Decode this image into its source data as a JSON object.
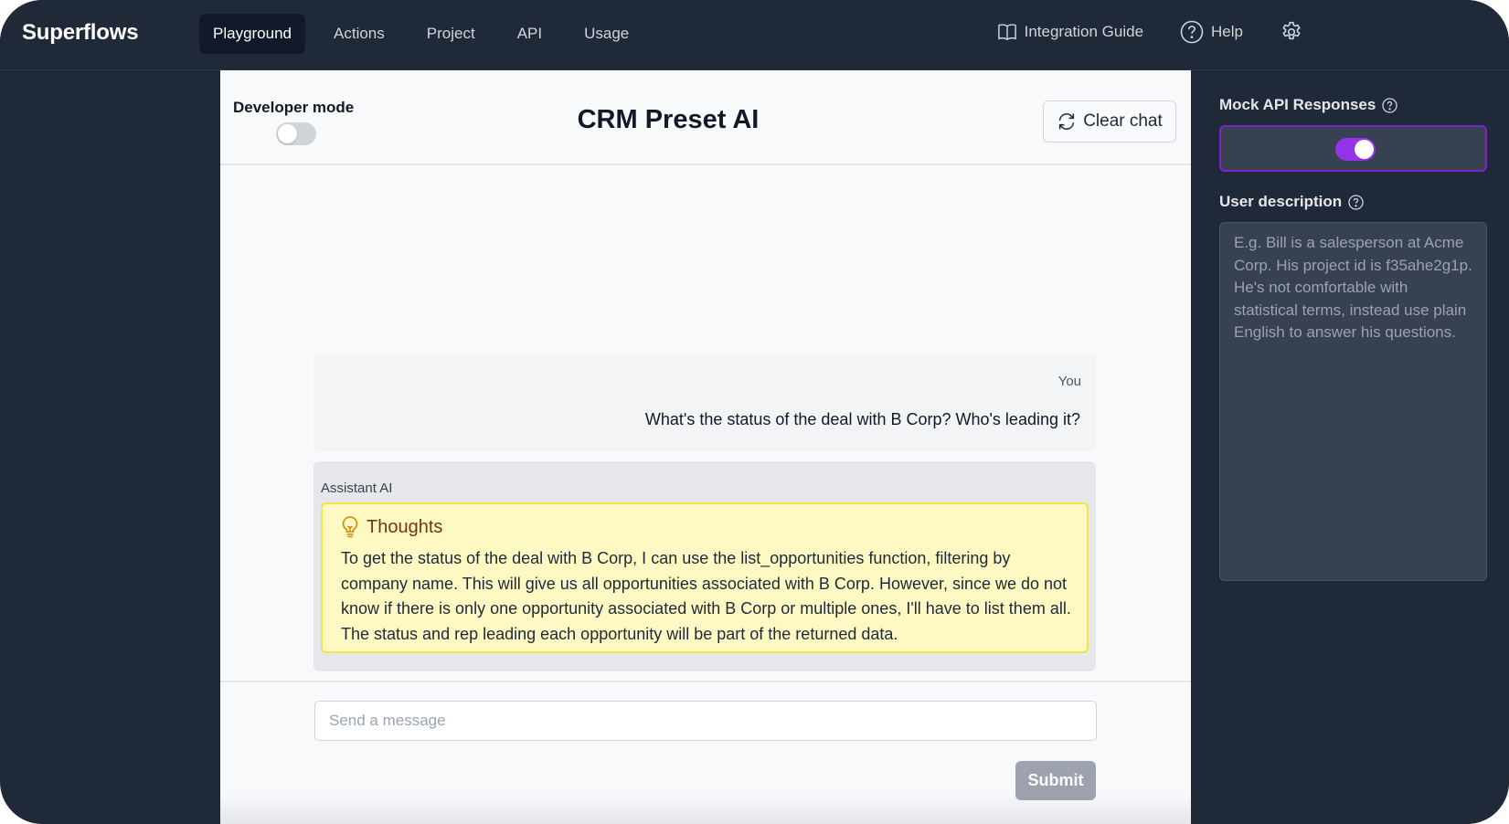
{
  "app": {
    "name": "Superflows"
  },
  "nav": {
    "items": [
      {
        "label": "Playground",
        "active": true
      },
      {
        "label": "Actions",
        "active": false
      },
      {
        "label": "Project",
        "active": false
      },
      {
        "label": "API",
        "active": false
      },
      {
        "label": "Usage",
        "active": false
      }
    ],
    "integration_guide": "Integration Guide",
    "help": "Help",
    "icons": {
      "guide": "book-open-icon",
      "help": "question-circle-icon",
      "settings": "gear-icon"
    }
  },
  "playground": {
    "developer_mode_label": "Developer mode",
    "developer_mode_on": false,
    "title": "CRM Preset AI",
    "clear_chat_label": "Clear chat",
    "messages": [
      {
        "role": "You",
        "text": "What's the status of the deal with B Corp? Who's leading it?"
      },
      {
        "role": "Assistant AI",
        "thoughts_title": "Thoughts",
        "thoughts_text": "To get the status of the deal with B Corp, I can use the list_opportunities function, filtering by company name. This will give us all opportunities associated with B Corp. However, since we do not know if there is only one opportunity associated with B Corp or multiple ones, I'll have to list them all. The status and rep leading each opportunity will be part of the returned data."
      }
    ],
    "input": {
      "placeholder": "Send a message",
      "value": ""
    },
    "submit_label": "Submit"
  },
  "sidebar": {
    "mock_api_label": "Mock API Responses",
    "mock_api_on": true,
    "user_description_label": "User description",
    "user_description_placeholder": "E.g. Bill is a salesperson at Acme Corp. His project id is f35ahe2g1p. He's not comfortable with statistical terms, instead use plain English to answer his questions.",
    "user_description_value": ""
  },
  "colors": {
    "accent": "#9333ea",
    "dark_bg": "#1f2937",
    "thoughts_bg": "#fef9c3"
  }
}
